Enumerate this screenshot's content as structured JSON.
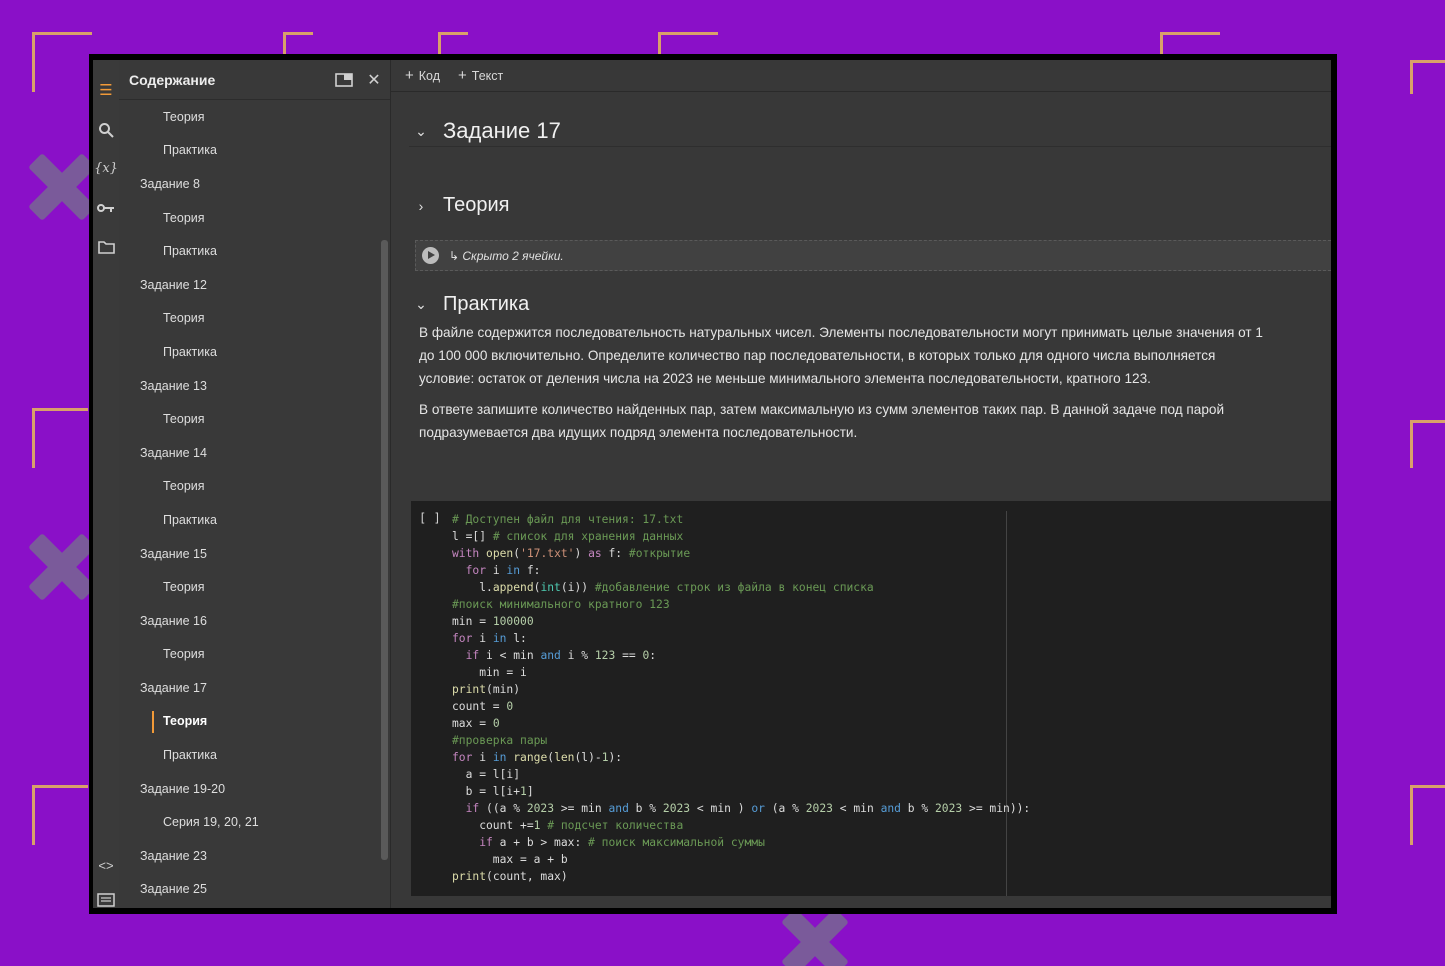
{
  "toc": {
    "title": "Содержание",
    "items": [
      {
        "label": "Теория",
        "level": 2
      },
      {
        "label": "Практика",
        "level": 2
      },
      {
        "label": "Задание 8",
        "level": 1
      },
      {
        "label": "Теория",
        "level": 2
      },
      {
        "label": "Практика",
        "level": 2
      },
      {
        "label": "Задание 12",
        "level": 1
      },
      {
        "label": "Теория",
        "level": 2
      },
      {
        "label": "Практика",
        "level": 2
      },
      {
        "label": "Задание 13",
        "level": 1
      },
      {
        "label": "Теория",
        "level": 2
      },
      {
        "label": "Задание 14",
        "level": 1
      },
      {
        "label": "Теория",
        "level": 2
      },
      {
        "label": "Практика",
        "level": 2
      },
      {
        "label": "Задание 15",
        "level": 1
      },
      {
        "label": "Теория",
        "level": 2
      },
      {
        "label": "Задание 16",
        "level": 1
      },
      {
        "label": "Теория",
        "level": 2
      },
      {
        "label": "Задание 17",
        "level": 1
      },
      {
        "label": "Теория",
        "level": 2,
        "selected": true
      },
      {
        "label": "Практика",
        "level": 2
      },
      {
        "label": "Задание 19-20",
        "level": 1
      },
      {
        "label": "Серия 19, 20, 21",
        "level": 2
      },
      {
        "label": "Задание 23",
        "level": 1
      },
      {
        "label": "Задание 25",
        "level": 1
      }
    ]
  },
  "toolbar": {
    "add_code_label": "Код",
    "add_text_label": "Текст"
  },
  "notebook": {
    "section_title": "Задание 17",
    "theory_title": "Теория",
    "hidden_cells_text": "Скрыто 2 ячейки.",
    "practice_title": "Практика",
    "paragraph1_line1": "В файле содержится последовательность натуральных чисел. Элементы последовательности могут принимать целые значения от 1",
    "paragraph1_line2": "до 100 000 включительно. Определите количество пар последовательности, в которых только для одного числа выполняется",
    "paragraph1_line3": "условие: остаток от деления числа на 2023 не меньше минимального элемента последовательности, кратного 123.",
    "paragraph2_line1": "В ответе запишите количество найденных пар, затем максимальную из сумм элементов таких пар. В данной задаче под парой",
    "paragraph2_line2": "подразумевается два идущих подряд элемента последовательности.",
    "cell_bracket": "[ ]"
  },
  "code": {
    "c1": "# Доступен файл для чтения: 17.txt",
    "c2": "# список для хранения данных",
    "c3": "#открытие",
    "c4": "#добавление строк из файла в конец списка",
    "c5": "#поиск минимального кратного 123",
    "c6": "#проверка пары",
    "c7": "# подсчет количества",
    "c8": "# поиск максимальной суммы"
  },
  "colors": {
    "background": "#8a10c8",
    "accent": "#f29a38",
    "panel": "#383838",
    "code_bg": "#1f1f1f"
  }
}
